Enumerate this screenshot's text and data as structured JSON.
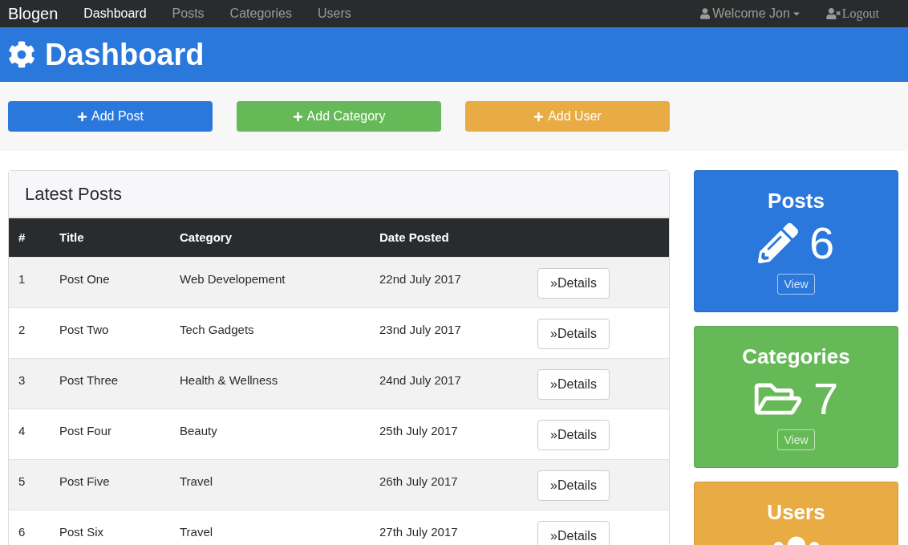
{
  "navbar": {
    "brand": "Blogen",
    "links": [
      {
        "label": "Dashboard",
        "selected": true
      },
      {
        "label": "Posts",
        "selected": false
      },
      {
        "label": "Categories",
        "selected": false
      },
      {
        "label": "Users",
        "selected": false
      }
    ],
    "user_menu": {
      "label": "Welcome Jon"
    },
    "logout": {
      "label": "Logout"
    }
  },
  "header": {
    "title": "Dashboard"
  },
  "actions": [
    {
      "label": "Add Post",
      "color": "#2b78dc"
    },
    {
      "label": "Add Category",
      "color": "#66b957"
    },
    {
      "label": "Add User",
      "color": "#e9ab43"
    }
  ],
  "latest_posts": {
    "title": "Latest Posts",
    "columns": [
      "#",
      "Title",
      "Category",
      "Date Posted"
    ],
    "rows": [
      {
        "number": "1",
        "title": "Post One",
        "category": "Web Developement",
        "date": "22nd July 2017",
        "action": "»Details"
      },
      {
        "number": "2",
        "title": "Post Two",
        "category": "Tech Gadgets",
        "date": "23nd July 2017",
        "action": "»Details"
      },
      {
        "number": "3",
        "title": "Post Three",
        "category": "Health & Wellness",
        "date": "24nd July 2017",
        "action": "»Details"
      },
      {
        "number": "4",
        "title": "Post Four",
        "category": "Beauty",
        "date": "25th July 2017",
        "action": "»Details"
      },
      {
        "number": "5",
        "title": "Post Five",
        "category": "Travel",
        "date": "26th July 2017",
        "action": "»Details"
      },
      {
        "number": "6",
        "title": "Post Six",
        "category": "Travel",
        "date": "27th July 2017",
        "action": "»Details"
      }
    ]
  },
  "stats": [
    {
      "kind": "posts",
      "title": "Posts",
      "count": "6",
      "button": "View",
      "color": "#2b78dc"
    },
    {
      "kind": "categories",
      "title": "Categories",
      "count": "7",
      "button": "View",
      "color": "#66b957"
    },
    {
      "kind": "users",
      "title": "Users",
      "color": "#e9ab43"
    }
  ]
}
